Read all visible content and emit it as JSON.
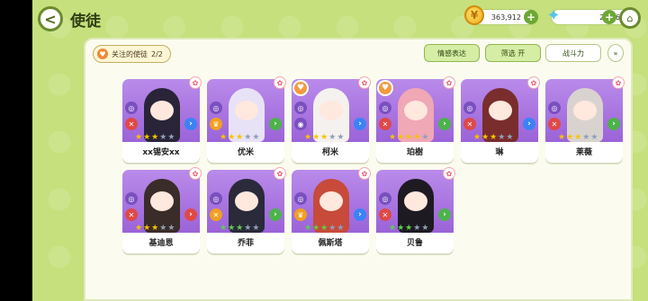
{
  "header": {
    "back_glyph": "<",
    "title": "使徒",
    "home_glyph": "⌂"
  },
  "resources": {
    "coin": {
      "value": "363,912",
      "icon": "coin-icon",
      "plus": "+"
    },
    "gem": {
      "value": "2,456",
      "icon": "gem-icon",
      "plus": "+"
    }
  },
  "toolbar": {
    "follow_label": "关注的使徒",
    "follow_count": "2/2",
    "emotion_label": "情感表达",
    "filter_label": "筛选 开",
    "power_label": "战斗力",
    "expand_glyph": "»"
  },
  "characters": [
    {
      "name": "xx锡安xx",
      "fav": false,
      "stars": [
        "gold",
        "gold",
        "gold",
        "gray",
        "gray"
      ],
      "body": "#2a2438",
      "badge2": "#e04848",
      "badge2_glyph": "✕",
      "arrow": "#3b82f6"
    },
    {
      "name": "优米",
      "fav": false,
      "stars": [
        "gold",
        "gold",
        "gold",
        "gray",
        "gray"
      ],
      "body": "#e8e2f6",
      "badge2": "#f0a020",
      "badge2_glyph": "♛",
      "arrow": "#4cb34a"
    },
    {
      "name": "柯米",
      "fav": true,
      "stars": [
        "gold",
        "gold",
        "gold",
        "gray",
        "gray"
      ],
      "body": "#f4f1ef",
      "badge2": "#7a4fc0",
      "badge2_glyph": "◉",
      "arrow": "#3b82f6"
    },
    {
      "name": "珀樹",
      "fav": true,
      "stars": [
        "gold",
        "gold",
        "gold",
        "gold",
        "gray"
      ],
      "body": "#f0a7b6",
      "badge2": "#e04848",
      "badge2_glyph": "✕",
      "arrow": "#4cb34a"
    },
    {
      "name": "琳",
      "fav": false,
      "stars": [
        "gold",
        "gold",
        "gold",
        "gray",
        "gray"
      ],
      "body": "#7a2d2d",
      "badge2": "#e04848",
      "badge2_glyph": "✕",
      "arrow": "#3b82f6"
    },
    {
      "name": "莱薇",
      "fav": false,
      "stars": [
        "gold",
        "gold",
        "gold",
        "gray",
        "gray"
      ],
      "body": "#d9d3d0",
      "badge2": "#e04848",
      "badge2_glyph": "✕",
      "arrow": "#4cb34a"
    },
    {
      "name": "基迪恩",
      "fav": false,
      "stars": [
        "gold",
        "gold",
        "gold",
        "gray",
        "gray"
      ],
      "body": "#3a2c28",
      "badge2": "#e04848",
      "badge2_glyph": "✕",
      "arrow": "#e04848"
    },
    {
      "name": "乔菲",
      "fav": false,
      "stars": [
        "green",
        "green",
        "green",
        "gray",
        "gray"
      ],
      "body": "#2a2a3a",
      "badge2": "#f0a020",
      "badge2_glyph": "✕",
      "arrow": "#4cb34a"
    },
    {
      "name": "佩斯塔",
      "fav": false,
      "stars": [
        "green",
        "green",
        "green",
        "gray",
        "gray"
      ],
      "body": "#c74a3a",
      "badge2": "#f0a020",
      "badge2_glyph": "♛",
      "arrow": "#3b82f6"
    },
    {
      "name": "贝鲁",
      "fav": false,
      "stars": [
        "green",
        "green",
        "green",
        "gray",
        "gray"
      ],
      "body": "#1e1a22",
      "badge2": "#e04848",
      "badge2_glyph": "✕",
      "arrow": "#4cb34a"
    }
  ]
}
